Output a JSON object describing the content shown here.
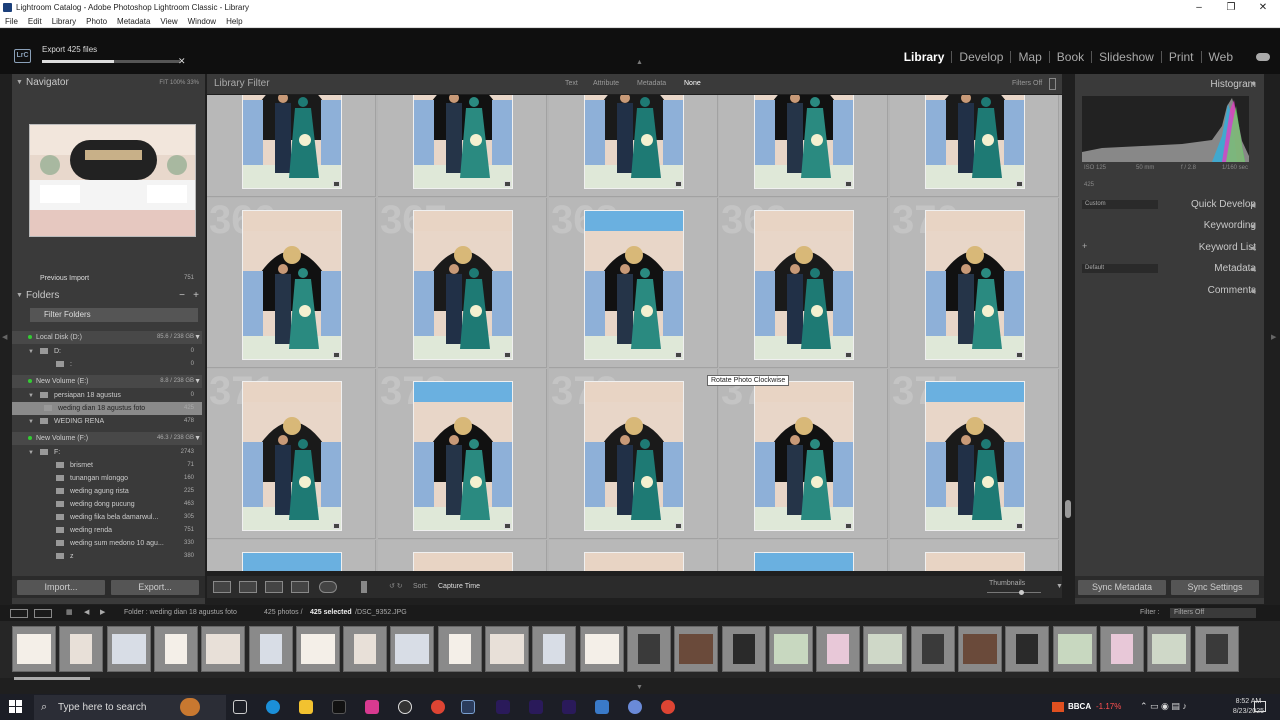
{
  "window": {
    "title": "Lightroom Catalog - Adobe Photoshop Lightroom Classic - Library"
  },
  "menu": [
    "File",
    "Edit",
    "Library",
    "Photo",
    "Metadata",
    "View",
    "Window",
    "Help"
  ],
  "top": {
    "badge": "LrC",
    "export_label": "Export 425 files",
    "export_progress": 0.52
  },
  "modules": [
    "Library",
    "Develop",
    "Map",
    "Book",
    "Slideshow",
    "Print",
    "Web"
  ],
  "active_module": "Library",
  "navigator": {
    "title": "Navigator",
    "options": "FIT  100%  33%"
  },
  "catalog": {
    "previous_import": "Previous Import",
    "previous_import_count": "751"
  },
  "folders": {
    "title": "Folders",
    "filter": "Filter Folders",
    "plus": "+",
    "minus": "−",
    "items": [
      {
        "type": "volume",
        "label": "Local Disk (D:)",
        "info": "85.6 / 238 GB"
      },
      {
        "type": "folder",
        "label": "D:",
        "count": "0"
      },
      {
        "type": "sub",
        "label": ":",
        "count": "0"
      },
      {
        "type": "volume",
        "label": "New Volume (E:)",
        "info": "8.8 / 238 GB"
      },
      {
        "type": "folder",
        "label": "persiapan 18 agustus",
        "count": "0"
      },
      {
        "type": "selected",
        "label": "weding dian 18 agustus foto",
        "count": "425"
      },
      {
        "type": "folder2",
        "label": "WEDING RENA",
        "count": "478"
      },
      {
        "type": "volume",
        "label": "New Volume (F:)",
        "info": "46.3 / 238 GB"
      },
      {
        "type": "folder2",
        "label": "F:",
        "count": "2743"
      },
      {
        "type": "sub",
        "label": "brismet",
        "count": "71"
      },
      {
        "type": "sub",
        "label": "tunangan mlonggo",
        "count": "160"
      },
      {
        "type": "sub",
        "label": "weding agung rista",
        "count": "225"
      },
      {
        "type": "sub",
        "label": "weding dong pucung",
        "count": "463"
      },
      {
        "type": "sub",
        "label": "weding fika bela damarwul...",
        "count": "305"
      },
      {
        "type": "sub",
        "label": "weding renda",
        "count": "751"
      },
      {
        "type": "sub",
        "label": "weding sum medono 10 agu...",
        "count": "330"
      },
      {
        "type": "sub",
        "label": "z",
        "count": "380"
      }
    ]
  },
  "buttons": {
    "import": "Import...",
    "export": "Export...",
    "sync_metadata": "Sync Metadata",
    "sync_settings": "Sync Settings"
  },
  "filter": {
    "title": "Library Filter",
    "tabs": [
      "Text",
      "Attribute",
      "Metadata",
      "None"
    ],
    "active": "None",
    "preset": "Filters Off"
  },
  "grid": {
    "row_numbers": [
      [
        "",
        "",
        "",
        "",
        ""
      ],
      [
        "366",
        "367",
        "368",
        "369",
        "370"
      ],
      [
        "371",
        "372",
        "373",
        "374",
        "375"
      ]
    ]
  },
  "tooltip": "Rotate Photo Clockwise",
  "toolbar": {
    "sort_label": "Sort:",
    "sort_value": "Capture Time",
    "thumbnails": "Thumbnails"
  },
  "histogram": {
    "title": "Histogram",
    "iso": "ISO 125",
    "focal": "50 mm",
    "aperture": "f / 2.8",
    "shutter": "1/160 sec",
    "count": "425"
  },
  "right_panels": [
    "Quick Develop",
    "Keywording",
    "Keyword List",
    "Metadata",
    "Comments"
  ],
  "right_selects": {
    "quick": "Custom",
    "metadata": "Default"
  },
  "filmstrip": {
    "path": "Folder : weding dian 18 agustus foto",
    "photos": "425 photos /",
    "selected": "425 selected",
    "file": "/DSC_9352.JPG",
    "filter_label": "Filter :",
    "filter_value": "Filters Off",
    "count": 26
  },
  "taskbar": {
    "search_placeholder": "Type here to search",
    "stock": "BBCA",
    "stock_change": "-1.17%",
    "time": "8:52 AM",
    "date": "8/23/2025"
  },
  "colors": {
    "accent_green": "#33cc33",
    "active_text": "#ffffff",
    "stock_red": "#ff5050"
  }
}
